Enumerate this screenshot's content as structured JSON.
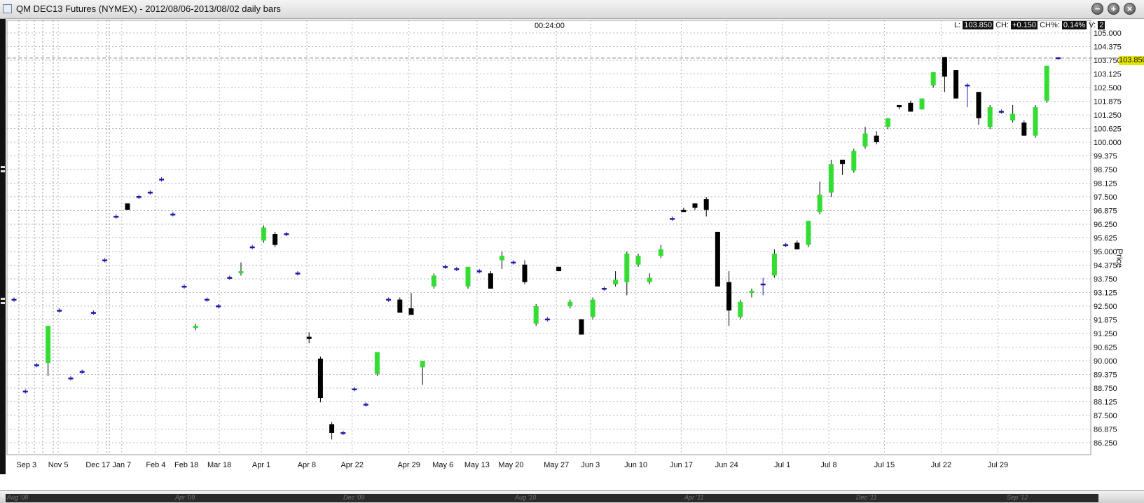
{
  "window": {
    "title": "QM DEC13 Futures (NYMEX) - 2012/08/06-2013/08/02 daily bars"
  },
  "header": {
    "clock": "00:24:00",
    "stats": {
      "low_label": "L:",
      "low_value": "103.850",
      "change_label": "CH:",
      "change_value": "+0.150",
      "change_pct_label": "CH%:",
      "change_pct_value": "0.14%",
      "volume_label": "V:",
      "volume_value": "2"
    },
    "last_price": "103.850"
  },
  "overview_labels": [
    "Aug '08",
    "Apr '09",
    "Dec '09",
    "Aug '10",
    "Apr '11",
    "Dec '11",
    "Sep '12"
  ],
  "colors": {
    "up": "#33dd33",
    "down": "#000000",
    "flat": "#1a1aaa",
    "last_tag": "#e4e400"
  },
  "chart_data": {
    "type": "candlestick",
    "ylabel": "Price",
    "ylim": [
      85.5,
      105.5
    ],
    "grid": true,
    "y_ticks": [
      "105.000",
      "104.375",
      "103.750",
      "103.125",
      "102.500",
      "101.875",
      "101.250",
      "100.625",
      "100.000",
      "99.375",
      "98.750",
      "98.125",
      "97.500",
      "96.875",
      "96.250",
      "95.625",
      "95.000",
      "94.375",
      "93.750",
      "93.125",
      "92.500",
      "91.875",
      "91.250",
      "90.625",
      "90.000",
      "89.375",
      "88.750",
      "88.125",
      "87.500",
      "86.875",
      "86.250"
    ],
    "x_ticks": [
      {
        "label": "Sep 3",
        "i": 0.6
      },
      {
        "label": "Nov 5",
        "i": 3.4
      },
      {
        "label": "Dec 17",
        "i": 6.9
      },
      {
        "label": "Jan 7",
        "i": 9.0
      },
      {
        "label": "Feb 4",
        "i": 12.0
      },
      {
        "label": "Feb 18",
        "i": 14.7
      },
      {
        "label": "Mar 18",
        "i": 17.6
      },
      {
        "label": "Apr 1",
        "i": 21.3
      },
      {
        "label": "Apr 8",
        "i": 25.3
      },
      {
        "label": "Apr 22",
        "i": 29.3
      },
      {
        "label": "Apr 29",
        "i": 34.3
      },
      {
        "label": "May 6",
        "i": 37.3
      },
      {
        "label": "May 13",
        "i": 40.3
      },
      {
        "label": "May 20",
        "i": 43.3
      },
      {
        "label": "May 27",
        "i": 47.3
      },
      {
        "label": "Jun 3",
        "i": 50.3
      },
      {
        "label": "Jun 10",
        "i": 54.3
      },
      {
        "label": "Jun 17",
        "i": 58.3
      },
      {
        "label": "Jun 24",
        "i": 62.3
      },
      {
        "label": "Jul 1",
        "i": 67.2
      },
      {
        "label": "Jul 8",
        "i": 71.3
      },
      {
        "label": "Jul 15",
        "i": 76.2
      },
      {
        "label": "Jul 22",
        "i": 81.2
      },
      {
        "label": "Jul 29",
        "i": 86.2
      }
    ],
    "bars": [
      {
        "o": 92.8,
        "h": 92.9,
        "l": 92.7,
        "c": 92.8
      },
      {
        "o": 88.6,
        "h": 88.7,
        "l": 88.5,
        "c": 88.6
      },
      {
        "o": 89.8,
        "h": 89.9,
        "l": 89.7,
        "c": 89.8
      },
      {
        "o": 89.9,
        "h": 91.6,
        "l": 89.3,
        "c": 91.6
      },
      {
        "o": 92.3,
        "h": 92.4,
        "l": 92.2,
        "c": 92.3
      },
      {
        "o": 89.2,
        "h": 89.3,
        "l": 89.1,
        "c": 89.2
      },
      {
        "o": 89.5,
        "h": 89.6,
        "l": 89.4,
        "c": 89.5
      },
      {
        "o": 92.2,
        "h": 92.3,
        "l": 92.1,
        "c": 92.2
      },
      {
        "o": 94.6,
        "h": 94.7,
        "l": 94.5,
        "c": 94.6
      },
      {
        "o": 96.6,
        "h": 96.7,
        "l": 96.5,
        "c": 96.6
      },
      {
        "o": 97.2,
        "h": 97.2,
        "l": 96.9,
        "c": 96.9
      },
      {
        "o": 97.5,
        "h": 97.6,
        "l": 97.4,
        "c": 97.5
      },
      {
        "o": 97.7,
        "h": 97.8,
        "l": 97.6,
        "c": 97.7
      },
      {
        "o": 98.3,
        "h": 98.4,
        "l": 98.2,
        "c": 98.3
      },
      {
        "o": 96.7,
        "h": 96.8,
        "l": 96.6,
        "c": 96.7
      },
      {
        "o": 93.4,
        "h": 93.5,
        "l": 93.3,
        "c": 93.4
      },
      {
        "o": 91.5,
        "h": 91.7,
        "l": 91.4,
        "c": 91.6
      },
      {
        "o": 92.8,
        "h": 92.9,
        "l": 92.7,
        "c": 92.8
      },
      {
        "o": 92.5,
        "h": 92.6,
        "l": 92.4,
        "c": 92.5
      },
      {
        "o": 93.8,
        "h": 93.9,
        "l": 93.7,
        "c": 93.8
      },
      {
        "o": 94.0,
        "h": 94.5,
        "l": 93.9,
        "c": 94.1
      },
      {
        "o": 95.2,
        "h": 95.3,
        "l": 95.1,
        "c": 95.2
      },
      {
        "o": 95.5,
        "h": 96.2,
        "l": 95.4,
        "c": 96.1
      },
      {
        "o": 95.8,
        "h": 95.9,
        "l": 95.2,
        "c": 95.3
      },
      {
        "o": 95.8,
        "h": 95.9,
        "l": 95.7,
        "c": 95.8
      },
      {
        "o": 94.0,
        "h": 94.1,
        "l": 93.9,
        "c": 94.0
      },
      {
        "o": 91.1,
        "h": 91.3,
        "l": 90.8,
        "c": 91.0
      },
      {
        "o": 90.1,
        "h": 90.2,
        "l": 88.1,
        "c": 88.3
      },
      {
        "o": 87.1,
        "h": 87.2,
        "l": 86.4,
        "c": 86.7
      },
      {
        "o": 86.7,
        "h": 86.8,
        "l": 86.6,
        "c": 86.7
      },
      {
        "o": 88.7,
        "h": 88.8,
        "l": 88.6,
        "c": 88.7
      },
      {
        "o": 88.0,
        "h": 88.1,
        "l": 87.9,
        "c": 88.0
      },
      {
        "o": 89.4,
        "h": 90.4,
        "l": 89.3,
        "c": 90.4
      },
      {
        "o": 92.8,
        "h": 92.9,
        "l": 92.7,
        "c": 92.8
      },
      {
        "o": 92.8,
        "h": 92.9,
        "l": 92.2,
        "c": 92.2
      },
      {
        "o": 92.4,
        "h": 93.1,
        "l": 92.1,
        "c": 92.1
      },
      {
        "o": 89.7,
        "h": 90.0,
        "l": 88.9,
        "c": 90.0
      },
      {
        "o": 93.4,
        "h": 94.0,
        "l": 93.3,
        "c": 93.9
      },
      {
        "o": 94.3,
        "h": 94.4,
        "l": 94.2,
        "c": 94.3
      },
      {
        "o": 94.2,
        "h": 94.3,
        "l": 94.1,
        "c": 94.2
      },
      {
        "o": 93.4,
        "h": 94.3,
        "l": 93.3,
        "c": 94.3
      },
      {
        "o": 94.1,
        "h": 94.2,
        "l": 94.0,
        "c": 94.1
      },
      {
        "o": 94.0,
        "h": 94.1,
        "l": 93.3,
        "c": 93.3
      },
      {
        "o": 94.6,
        "h": 95.0,
        "l": 94.2,
        "c": 94.8
      },
      {
        "o": 94.5,
        "h": 94.6,
        "l": 94.4,
        "c": 94.5
      },
      {
        "o": 94.4,
        "h": 94.6,
        "l": 93.5,
        "c": 93.6
      },
      {
        "o": 91.7,
        "h": 92.6,
        "l": 91.6,
        "c": 92.5
      },
      {
        "o": 91.9,
        "h": 92.0,
        "l": 91.8,
        "c": 91.9
      },
      {
        "o": 94.3,
        "h": 94.3,
        "l": 94.1,
        "c": 94.1
      },
      {
        "o": 92.5,
        "h": 92.8,
        "l": 92.4,
        "c": 92.7
      },
      {
        "o": 91.9,
        "h": 91.9,
        "l": 91.2,
        "c": 91.2
      },
      {
        "o": 92.0,
        "h": 92.9,
        "l": 91.9,
        "c": 92.8
      },
      {
        "o": 93.3,
        "h": 93.4,
        "l": 93.2,
        "c": 93.3
      },
      {
        "o": 93.5,
        "h": 94.1,
        "l": 93.4,
        "c": 93.7
      },
      {
        "o": 93.6,
        "h": 95.0,
        "l": 93.0,
        "c": 94.9
      },
      {
        "o": 94.4,
        "h": 94.9,
        "l": 94.3,
        "c": 94.8
      },
      {
        "o": 93.6,
        "h": 94.0,
        "l": 93.5,
        "c": 93.8
      },
      {
        "o": 94.8,
        "h": 95.3,
        "l": 94.7,
        "c": 95.1
      },
      {
        "o": 96.5,
        "h": 96.6,
        "l": 96.4,
        "c": 96.5
      },
      {
        "o": 96.9,
        "h": 97.0,
        "l": 96.8,
        "c": 96.8
      },
      {
        "o": 97.2,
        "h": 97.2,
        "l": 96.9,
        "c": 97.0
      },
      {
        "o": 97.4,
        "h": 97.5,
        "l": 96.6,
        "c": 96.9
      },
      {
        "o": 95.9,
        "h": 95.9,
        "l": 93.4,
        "c": 93.4
      },
      {
        "o": 93.6,
        "h": 94.1,
        "l": 91.6,
        "c": 92.3
      },
      {
        "o": 92.0,
        "h": 92.8,
        "l": 91.9,
        "c": 92.7
      },
      {
        "o": 93.1,
        "h": 93.3,
        "l": 92.9,
        "c": 93.2
      },
      {
        "o": 93.5,
        "h": 93.8,
        "l": 93.0,
        "c": 93.5
      },
      {
        "o": 93.9,
        "h": 95.1,
        "l": 93.8,
        "c": 94.9
      },
      {
        "o": 95.3,
        "h": 95.4,
        "l": 95.2,
        "c": 95.3
      },
      {
        "o": 95.4,
        "h": 95.5,
        "l": 95.1,
        "c": 95.1
      },
      {
        "o": 95.3,
        "h": 96.4,
        "l": 95.2,
        "c": 96.4
      },
      {
        "o": 96.8,
        "h": 98.2,
        "l": 96.7,
        "c": 97.6
      },
      {
        "o": 97.7,
        "h": 99.2,
        "l": 97.5,
        "c": 99.0
      },
      {
        "o": 99.2,
        "h": 99.2,
        "l": 98.5,
        "c": 99.0
      },
      {
        "o": 98.7,
        "h": 99.7,
        "l": 98.6,
        "c": 99.6
      },
      {
        "o": 99.8,
        "h": 100.7,
        "l": 99.7,
        "c": 100.4
      },
      {
        "o": 100.3,
        "h": 100.5,
        "l": 99.9,
        "c": 100.0
      },
      {
        "o": 100.7,
        "h": 101.1,
        "l": 100.6,
        "c": 101.1
      },
      {
        "o": 101.7,
        "h": 101.7,
        "l": 101.5,
        "c": 101.6
      },
      {
        "o": 101.8,
        "h": 101.9,
        "l": 101.4,
        "c": 101.4
      },
      {
        "o": 101.5,
        "h": 102.0,
        "l": 101.5,
        "c": 102.0
      },
      {
        "o": 102.6,
        "h": 103.2,
        "l": 102.5,
        "c": 103.2
      },
      {
        "o": 103.9,
        "h": 103.9,
        "l": 102.3,
        "c": 103.0
      },
      {
        "o": 103.3,
        "h": 103.3,
        "l": 102.0,
        "c": 102.0
      },
      {
        "o": 102.6,
        "h": 102.7,
        "l": 101.6,
        "c": 102.6
      },
      {
        "o": 102.3,
        "h": 102.3,
        "l": 100.8,
        "c": 101.1
      },
      {
        "o": 100.7,
        "h": 101.7,
        "l": 100.6,
        "c": 101.6
      },
      {
        "o": 101.4,
        "h": 101.5,
        "l": 101.3,
        "c": 101.4
      },
      {
        "o": 101.0,
        "h": 101.7,
        "l": 100.9,
        "c": 101.3
      },
      {
        "o": 100.9,
        "h": 101.0,
        "l": 100.3,
        "c": 100.3
      },
      {
        "o": 100.3,
        "h": 101.7,
        "l": 100.2,
        "c": 101.6
      },
      {
        "o": 101.9,
        "h": 103.5,
        "l": 101.8,
        "c": 103.5
      },
      {
        "o": 103.8,
        "h": 103.9,
        "l": 103.8,
        "c": 103.85
      }
    ]
  }
}
